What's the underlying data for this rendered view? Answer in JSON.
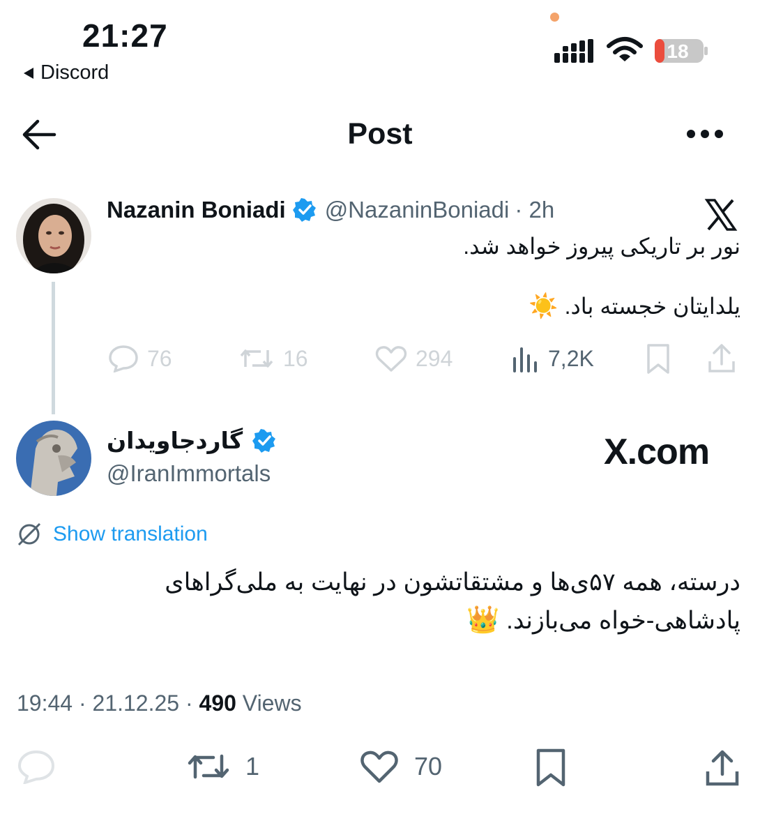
{
  "status_bar": {
    "time": "21:27",
    "back_app": "Discord",
    "battery": "18",
    "icons": [
      "signal-icon",
      "wifi-icon",
      "battery-icon"
    ]
  },
  "header": {
    "title": "Post",
    "back_icon": "arrow-left-icon",
    "more_icon": "more-horizontal-icon"
  },
  "quoted_tweet": {
    "name": "Nazanin Boniadi",
    "handle": "@NazaninBoniadi",
    "time": "· 2h",
    "line1": "نور بر تاریکی پیروز خواهد شد.",
    "line2": "یلدایتان خجسته باد.",
    "emoji": "☀️",
    "actions": {
      "replies": "76",
      "reposts": "16",
      "likes": "294",
      "views": "7,2K"
    }
  },
  "main_tweet": {
    "name": "گاردجاویدان",
    "handle": "@IranImmortals",
    "watermark": "X.com",
    "show_translation": "Show translation",
    "line1": "درسته، همه ۵۷ی‌ها و مشتقاتشون در نهایت به ملی‌گراهای",
    "line2": "پادشاهی-خواه می‌بازند.",
    "emoji": "👑",
    "meta": {
      "time": "19:44",
      "date": "21.12.25",
      "views_count": "490",
      "views_label": "Views"
    },
    "actions": {
      "reposts": "1",
      "likes": "70"
    }
  },
  "colors": {
    "text": "#0f1419",
    "secondary": "#536471",
    "link": "#1d9bf0",
    "verified": "#1d9bf0",
    "faded": "#cfd4d8"
  }
}
